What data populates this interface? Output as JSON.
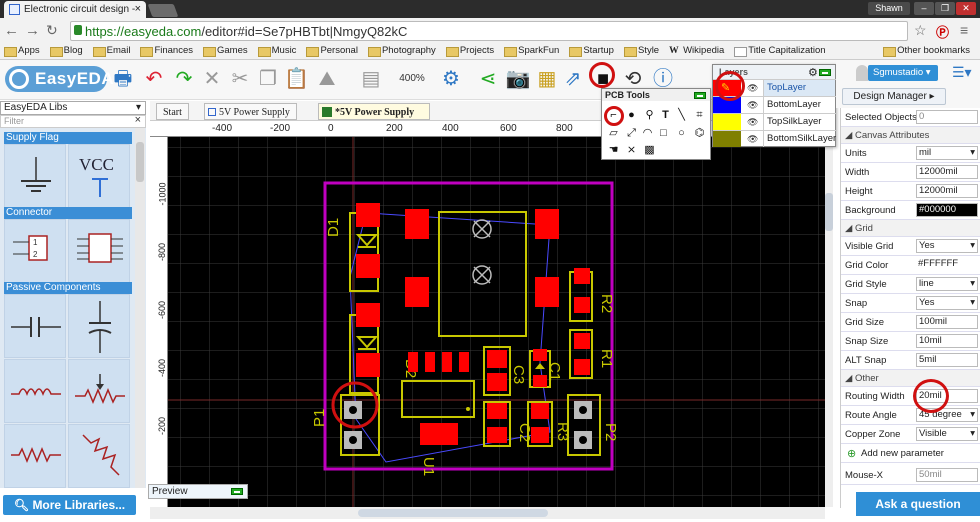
{
  "browser": {
    "tab_title": "Electronic circuit design -",
    "tab_close": "×",
    "user": "Shawn",
    "url_host": "https://easyeda.com",
    "url_path": "/editor#id=Se7pHBTbt|NmgyQ82kC",
    "bookmarks": [
      "Apps",
      "Blog",
      "Email",
      "Finances",
      "Games",
      "Music",
      "Personal",
      "Photography",
      "Projects",
      "SparkFun",
      "Startup",
      "Style",
      "Wikipedia",
      "Title Capitalization"
    ],
    "other_bookmarks": "Other bookmarks"
  },
  "app": {
    "logo": "EasyEDA",
    "zoom": "400%",
    "libs_title": "EasyEDA Libs",
    "filter_placeholder": "Filter",
    "categories": [
      "Supply Flag",
      "Connector",
      "Passive Components"
    ],
    "vcc": "VCC",
    "more_libraries": "More Libraries...",
    "tabs": [
      "Start",
      "5V Power Supply",
      "*5V Power Supply"
    ],
    "preview": "Preview"
  },
  "ruler": {
    "top": [
      "-400",
      "-200",
      "0",
      "200",
      "400",
      "600",
      "800"
    ],
    "left": [
      "-1000",
      "-800",
      "-600",
      "-400",
      "-200"
    ]
  },
  "pcb_tools": {
    "title": "PCB Tools"
  },
  "layers": {
    "title": "Layers",
    "items": [
      {
        "name": "TopLayer",
        "color": "#ff0000"
      },
      {
        "name": "BottomLayer",
        "color": "#0000ff"
      },
      {
        "name": "TopSilkLayer",
        "color": "#ffff00"
      },
      {
        "name": "BottomSilkLayer",
        "color": "#808000"
      }
    ]
  },
  "right": {
    "username": "Sgmustadio",
    "design_manager": "Design Manager",
    "selected_label": "Selected Objects",
    "selected_value": "0",
    "canvas_section": "Canvas Attributes",
    "canvas": [
      {
        "k": "Units",
        "v": "mil"
      },
      {
        "k": "Width",
        "v": "12000mil"
      },
      {
        "k": "Height",
        "v": "12000mil"
      },
      {
        "k": "Background",
        "v": "#000000"
      }
    ],
    "grid_section": "Grid",
    "grid": [
      {
        "k": "Visible Grid",
        "v": "Yes"
      },
      {
        "k": "Grid Color",
        "v": "#FFFFFF"
      },
      {
        "k": "Grid Style",
        "v": "line"
      },
      {
        "k": "Snap",
        "v": "Yes"
      },
      {
        "k": "Grid Size",
        "v": "100mil"
      },
      {
        "k": "Snap Size",
        "v": "10mil"
      },
      {
        "k": "ALT Snap",
        "v": "5mil"
      }
    ],
    "other_section": "Other",
    "other": [
      {
        "k": "Routing Width",
        "v": "20mil"
      },
      {
        "k": "Route Angle",
        "v": "45 degree"
      },
      {
        "k": "Copper Zone",
        "v": "Visible"
      }
    ],
    "add_param": "Add new parameter",
    "mouse_x_label": "Mouse-X",
    "mouse_x_value": "50mil",
    "ask": "Ask a question"
  },
  "pcb_labels": {
    "D1": "D1",
    "D2": "D2",
    "R1": "R1",
    "R2": "R2",
    "C1": "C1",
    "C2": "C2",
    "C3": "C3",
    "R3": "R3",
    "P1": "P1",
    "P2": "P2",
    "U1": "U1"
  },
  "colors": {
    "pad": "#ff0000",
    "silk": "#c8c800",
    "outline": "#c000c0",
    "grid": "#3a3a3a",
    "accent": "#2f8fd6",
    "highlight": "#d01010"
  }
}
